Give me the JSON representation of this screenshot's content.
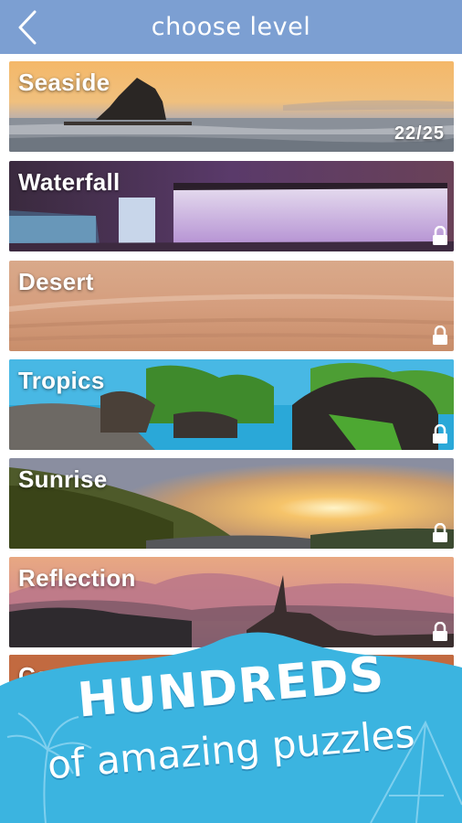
{
  "header": {
    "title": "choose level",
    "back_icon": "chevron-left-icon"
  },
  "levels": [
    {
      "name": "Seaside",
      "progress": "22/25",
      "locked": false
    },
    {
      "name": "Waterfall",
      "locked": true
    },
    {
      "name": "Desert",
      "locked": true
    },
    {
      "name": "Tropics",
      "locked": true
    },
    {
      "name": "Sunrise",
      "locked": true
    },
    {
      "name": "Reflection",
      "locked": true
    },
    {
      "name": "Can",
      "locked": true
    }
  ],
  "promo": {
    "headline": "HUNDREDS",
    "subline": "of amazing puzzles",
    "color": "#3bb4e0"
  },
  "colors": {
    "header_bg": "#7c9fd2",
    "promo_bg": "#3bb4e0"
  }
}
